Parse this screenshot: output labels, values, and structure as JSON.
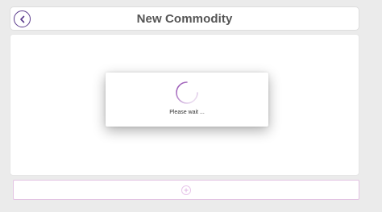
{
  "header": {
    "title": "New Commodity",
    "back_icon": "chevron-left-icon"
  },
  "loading": {
    "message": "Please wait ..."
  },
  "footer": {
    "add_icon": "plus-icon"
  },
  "colors": {
    "accent": "#5a3a8c",
    "spinner": "#8e44ad",
    "footer_border": "#e3c4e3"
  }
}
